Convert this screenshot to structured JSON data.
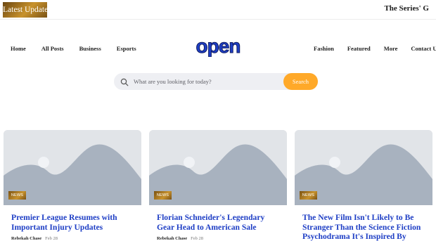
{
  "topbar": {
    "latest_label": "Latest Update",
    "ticker_text": "The Series' G"
  },
  "nav": {
    "left": [
      "Home",
      "All Posts",
      "Business",
      "Esports"
    ],
    "right": [
      "Fashion",
      "Featured",
      "More",
      "Contact Us"
    ]
  },
  "logo": {
    "text": "open",
    "color": "#1e3ec5"
  },
  "search": {
    "placeholder": "What are you looking for today?",
    "button_label": "Search",
    "button_color": "#ffa929"
  },
  "posts": [
    {
      "badge": "NEWS",
      "title": "Premier League Resumes with Important Injury Updates",
      "author": "Rebekah Chase",
      "date": "Feb 28"
    },
    {
      "badge": "NEWS",
      "title": "Florian Schneider's Legendary Gear Head to American Sale",
      "author": "Rebekah Chase",
      "date": "Feb 28"
    },
    {
      "badge": "NEWS",
      "title": "The New Film Isn't Likely to Be Stranger Than the Science Fiction Psychodrama It's Inspired By",
      "author": "",
      "date": ""
    }
  ]
}
